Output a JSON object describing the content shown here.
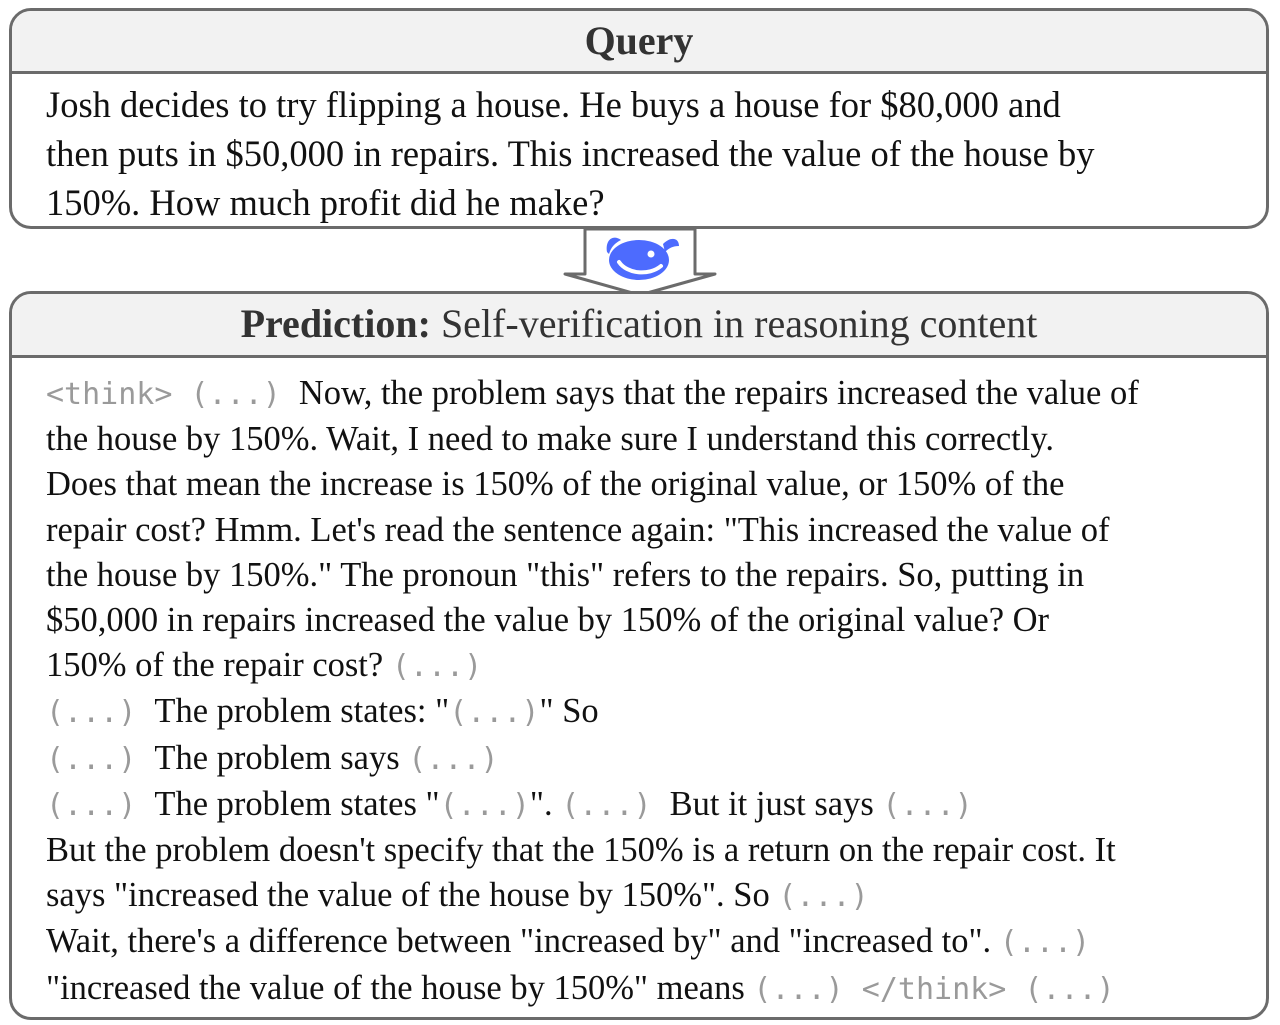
{
  "query": {
    "title": "Query",
    "lines": [
      "Josh decides to try flipping a house.  He buys a house for $80,000 and",
      "then puts in $50,000 in repairs.  This increased the value of the house by",
      "150%.  How much profit did he make?"
    ]
  },
  "connector": {
    "icon": "whale-logo-icon",
    "color": "#4d6bfe"
  },
  "prediction": {
    "title_bold": "Prediction:",
    "title_rest": " Self-verification in reasoning content",
    "lines": [
      [
        {
          "t": "<think> (...) ",
          "m": true
        },
        {
          "t": "Now, the problem says that the repairs increased the value of"
        }
      ],
      [
        {
          "t": "the house by 150%. Wait, I need to make sure I understand this correctly."
        }
      ],
      [
        {
          "t": "Does that mean the increase is 150% of the original value, or 150% of the"
        }
      ],
      [
        {
          "t": "repair cost? Hmm. Let's read the sentence again: \"This increased the value of"
        }
      ],
      [
        {
          "t": "the house by 150%.\" The pronoun \"this\" refers to the repairs. So, putting in"
        }
      ],
      [
        {
          "t": "$50,000 in repairs increased the value by 150% of the original value? Or"
        }
      ],
      [
        {
          "t": "150% of the repair cost? "
        },
        {
          "t": "(...)",
          "m": true
        }
      ],
      [
        {
          "t": "(...) ",
          "m": true
        },
        {
          "t": "The problem states: \""
        },
        {
          "t": "(...)",
          "m": true
        },
        {
          "t": "\" So"
        }
      ],
      [
        {
          "t": "(...) ",
          "m": true
        },
        {
          "t": "The problem says "
        },
        {
          "t": "(...)",
          "m": true
        }
      ],
      [
        {
          "t": "(...) ",
          "m": true
        },
        {
          "t": "The problem states \""
        },
        {
          "t": "(...)",
          "m": true
        },
        {
          "t": "\". "
        },
        {
          "t": "(...) ",
          "m": true
        },
        {
          "t": "But it just says "
        },
        {
          "t": "(...)",
          "m": true
        }
      ],
      [
        {
          "t": "But the problem doesn't specify that the 150% is a return on the repair cost. It"
        }
      ],
      [
        {
          "t": "says \"increased the value of the house by 150%\". So "
        },
        {
          "t": "(...)",
          "m": true
        }
      ],
      [
        {
          "t": "Wait, there's a difference between \"increased by\" and \"increased to\". "
        },
        {
          "t": "(...)",
          "m": true
        }
      ],
      [
        {
          "t": "\"increased the value of the house by 150%\" means "
        },
        {
          "t": "(...) </think> (...)",
          "m": true
        }
      ]
    ]
  }
}
